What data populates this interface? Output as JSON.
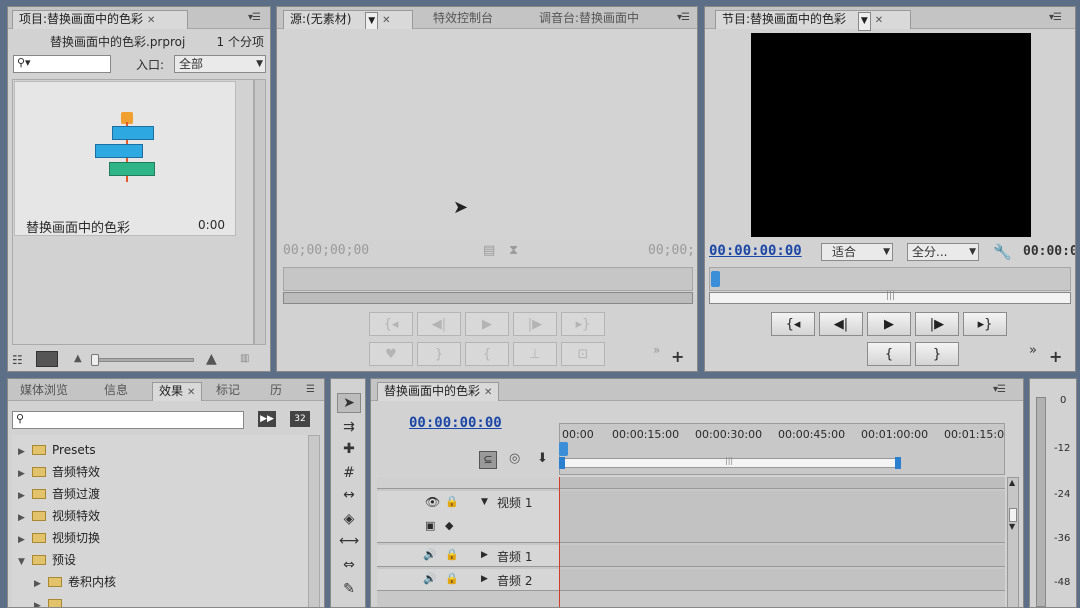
{
  "project": {
    "tab_label": "项目:替换画面中的色彩",
    "file_name": "替换画面中的色彩.prproj",
    "item_count": "1 个分项",
    "search_placeholder": "",
    "entry_label": "入口:",
    "entry_value": "全部",
    "item_name": "替换画面中的色彩",
    "item_duration": "0:00"
  },
  "source": {
    "tabs": [
      "源:(无素材)",
      "特效控制台",
      "调音台:替换画面中"
    ],
    "timecode_left": "00;00;00;00",
    "timecode_right": "00;00;"
  },
  "program": {
    "tab_label": "节目:替换画面中的色彩",
    "timecode": "00:00:00:00",
    "fit_value": "适合",
    "res_value": "全分...",
    "timecode_right": "00:00:0"
  },
  "effects": {
    "tabs": [
      "媒体浏览",
      "信息",
      "效果",
      "标记",
      "历"
    ],
    "search_placeholder": "",
    "items": [
      {
        "label": "Presets",
        "expanded": false
      },
      {
        "label": "音频特效",
        "expanded": false
      },
      {
        "label": "音频过渡",
        "expanded": false
      },
      {
        "label": "视频特效",
        "expanded": false
      },
      {
        "label": "视频切换",
        "expanded": false
      },
      {
        "label": "预设",
        "expanded": true
      },
      {
        "label": "卷积内核",
        "expanded": false,
        "child": true
      },
      {
        "label": "",
        "expanded": false,
        "child": true
      }
    ]
  },
  "timeline": {
    "tab_label": "替换画面中的色彩",
    "timecode": "00:00:00:00",
    "ruler": [
      "00:00",
      "00:00:15:00",
      "00:00:30:00",
      "00:00:45:00",
      "00:01:00:00",
      "00:01:15:0"
    ],
    "tracks": [
      {
        "label": "",
        "kind": "video"
      },
      {
        "label": "视频 1",
        "kind": "video"
      },
      {
        "label": "音频 1",
        "kind": "audio"
      },
      {
        "label": "音频 2",
        "kind": "audio"
      }
    ]
  },
  "meter": {
    "labels": [
      "0",
      "-12",
      "-24",
      "-36",
      "-48"
    ]
  },
  "icons": {
    "tools": [
      "selection-tool-icon",
      "track-select-icon",
      "ripple-edit-icon",
      "rolling-edit-icon",
      "rate-stretch-icon",
      "razor-icon",
      "slip-icon",
      "slide-icon",
      "pen-icon",
      "hand-icon"
    ]
  }
}
